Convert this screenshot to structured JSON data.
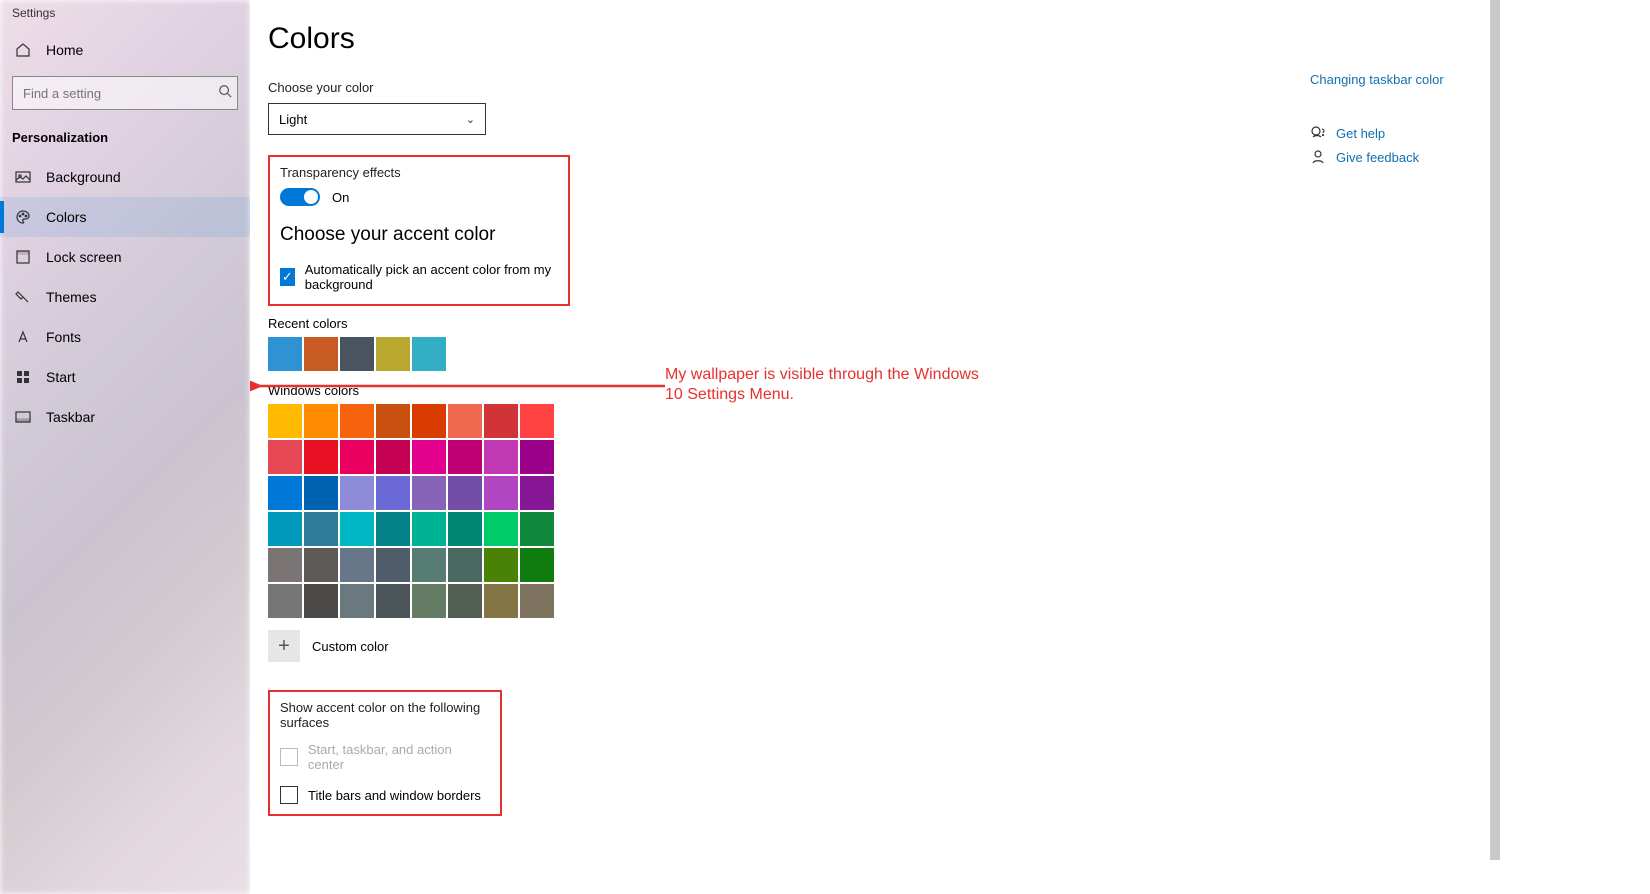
{
  "app_title": "Settings",
  "home_label": "Home",
  "search_placeholder": "Find a setting",
  "section_label": "Personalization",
  "nav_items": [
    {
      "label": "Background",
      "icon": "image-icon"
    },
    {
      "label": "Colors",
      "icon": "palette-icon"
    },
    {
      "label": "Lock screen",
      "icon": "lockscreen-icon"
    },
    {
      "label": "Themes",
      "icon": "themes-icon"
    },
    {
      "label": "Fonts",
      "icon": "fonts-icon"
    },
    {
      "label": "Start",
      "icon": "start-icon"
    },
    {
      "label": "Taskbar",
      "icon": "taskbar-icon"
    }
  ],
  "selected_nav_index": 1,
  "page_title": "Colors",
  "choose_color_label": "Choose your color",
  "choose_color_value": "Light",
  "transparency_label": "Transparency effects",
  "transparency_state": "On",
  "accent_heading": "Choose your accent color",
  "auto_pick_label": "Automatically pick an accent color from my background",
  "recent_label": "Recent colors",
  "recent_colors": [
    "#2e92d3",
    "#c85a23",
    "#4a5460",
    "#b9a82f",
    "#34aec5"
  ],
  "windows_colors_label": "Windows colors",
  "windows_colors": [
    "#ffb900",
    "#ff8c00",
    "#f7630c",
    "#ca5010",
    "#da3b01",
    "#ef6950",
    "#d13438",
    "#ff4343",
    "#e74856",
    "#e81123",
    "#ea005e",
    "#c30052",
    "#e3008c",
    "#bf0077",
    "#c239b3",
    "#9a0089",
    "#0078d7",
    "#0063b1",
    "#8e8cd8",
    "#6b69d6",
    "#8764b8",
    "#744da9",
    "#b146c2",
    "#881798",
    "#0099bc",
    "#2d7d9a",
    "#00b7c3",
    "#038387",
    "#00b294",
    "#018574",
    "#00cc6a",
    "#10893e",
    "#7a7574",
    "#5d5a58",
    "#68768a",
    "#515c6b",
    "#567c73",
    "#486860",
    "#498205",
    "#107c10",
    "#767676",
    "#4c4a48",
    "#69797e",
    "#4a5459",
    "#647c64",
    "#525e54",
    "#847545",
    "#7e735f"
  ],
  "custom_color_label": "Custom color",
  "surfaces_heading": "Show accent color on the following surfaces",
  "surface_opt_1": "Start, taskbar, and action center",
  "surface_opt_2": "Title bars and window borders",
  "annotation_text": "My wallpaper is visible through the Windows 10 Settings Menu.",
  "right": {
    "link_top": "Changing taskbar color",
    "help": "Get help",
    "feedback": "Give feedback"
  }
}
